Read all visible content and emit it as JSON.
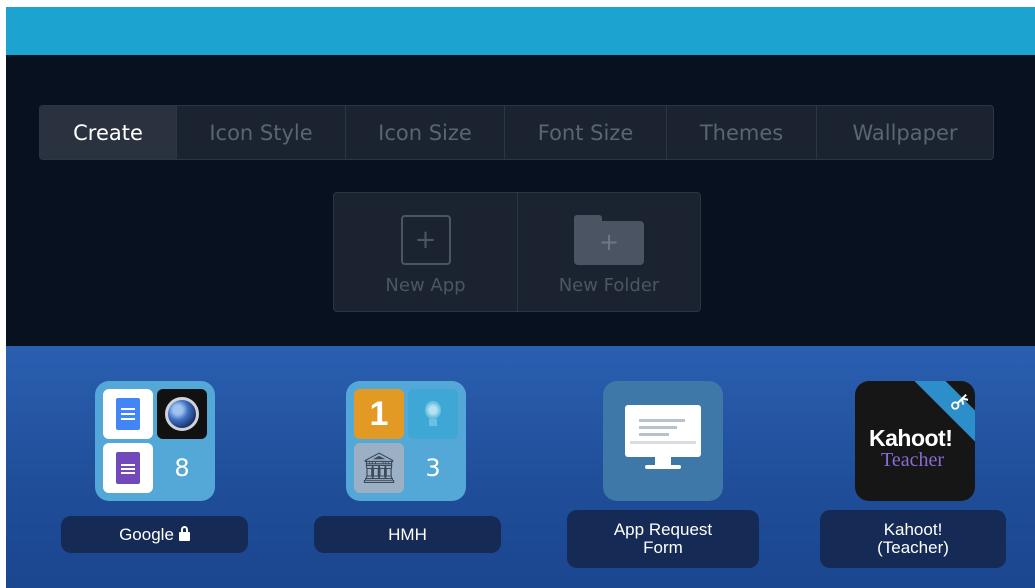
{
  "tabs": [
    {
      "label": "Create",
      "active": true
    },
    {
      "label": "Icon Style",
      "active": false
    },
    {
      "label": "Icon Size",
      "active": false
    },
    {
      "label": "Font Size",
      "active": false
    },
    {
      "label": "Themes",
      "active": false
    },
    {
      "label": "Wallpaper",
      "active": false
    }
  ],
  "create": {
    "new_app_label": "New App",
    "new_app_icon": "plus-square-icon",
    "new_folder_label": "New Folder",
    "new_folder_icon": "folder-plus-icon"
  },
  "apps": {
    "google": {
      "label": "Google",
      "count": "8",
      "locked": true,
      "icons": [
        "google-docs-icon",
        "google-earth-icon",
        "google-forms-icon"
      ]
    },
    "hmh": {
      "label": "HMH",
      "count": "3",
      "icons": [
        "one-icon",
        "lightbulb-icon",
        "museum-icon"
      ],
      "one_text": "1"
    },
    "app_request": {
      "label_line1": "App Request",
      "label_line2": "Form",
      "icon": "monitor-icon"
    },
    "kahoot": {
      "label_line1": "Kahoot!",
      "label_line2": "(Teacher)",
      "logo_text": "Kahoot!",
      "logo_sub": "Teacher",
      "icon": "key-icon"
    }
  },
  "colors": {
    "top_bar": "#1ca3cf",
    "dark_panel": "#07111f",
    "app_background": "#2a5fb0",
    "label_background": "#152a55"
  }
}
